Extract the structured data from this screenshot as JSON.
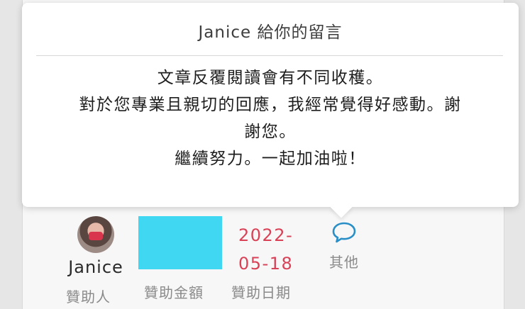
{
  "popover": {
    "title": "Janice 給你的留言",
    "lines": [
      "文章反覆閱讀會有不同收穫。",
      "對於您專業且親切的回應，我經常覺得好感動。謝",
      "謝您。",
      "繼續努力。一起加油啦！"
    ]
  },
  "sponsor": {
    "name": "Janice",
    "role_label": "贊助人"
  },
  "amount": {
    "label": "贊助金額",
    "redaction_color": "#3fd7f2"
  },
  "date": {
    "value_line1": "2022-",
    "value_line2": "05-18",
    "label": "贊助日期",
    "color": "#d94157"
  },
  "other": {
    "icon": "chat-bubble-icon",
    "label": "其他",
    "color": "#2a8fc7"
  }
}
